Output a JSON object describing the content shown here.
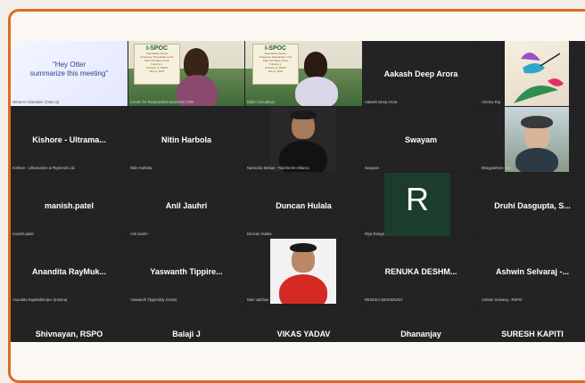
{
  "meeting": {
    "otter_prompt": "\"Hey Otter\nsummarize this meeting\"",
    "slide_title": "I-SPOC",
    "slide_lines": [
      "Traceability Series:",
      "Achieving Traceability in the",
      "Palm Oil Value Chain",
      "Training 1:",
      "prinsiple by RSPO",
      "May 8, 2024"
    ]
  },
  "tiles": [
    {
      "id": "otter",
      "label": "",
      "caption": "Miriam's Notetaker (Otter.ai)"
    },
    {
      "id": "crb",
      "label": "",
      "caption": "Centre for Responsible Business CRB"
    },
    {
      "id": "nidhi",
      "label": "",
      "caption": "Nidhi Choudhary"
    },
    {
      "id": "aakash",
      "label": "Aakash Deep Arora",
      "caption": "Aakash Deep Arora"
    },
    {
      "id": "chetna",
      "label": "",
      "caption": "Chetna Raj"
    },
    {
      "id": "kishore",
      "label": "Kishore - Ultrama...",
      "caption": "Kishore - Ultramarine & Pigments Ltd."
    },
    {
      "id": "nitinh",
      "label": "Nitin Harbola",
      "caption": "Nitin Harbola"
    },
    {
      "id": "narendra",
      "label": "",
      "caption": "Narendra Mohan - Rainforest Alliance"
    },
    {
      "id": "swayam",
      "label": "Swayam",
      "caption": "Swayam"
    },
    {
      "id": "bhagyashree",
      "label": "",
      "caption": "Bhagyashree Jain"
    },
    {
      "id": "manish",
      "label": "manish.patel",
      "caption": "manish.patel"
    },
    {
      "id": "anil",
      "label": "Anil Jauhri",
      "caption": "Anil Jauhri"
    },
    {
      "id": "duncan",
      "label": "Duncan Hulala",
      "caption": "Duncan Hulala"
    },
    {
      "id": "riya",
      "label": "",
      "caption": "Riya Ranga",
      "initial": "R"
    },
    {
      "id": "druhi",
      "label": "Druhi Dasgupta, S...",
      "caption": ""
    },
    {
      "id": "anandita",
      "label": "Anandita RayMuk...",
      "caption": "Anandita RayMukherjee (trustea)"
    },
    {
      "id": "yaswanth",
      "label": "Yaswanth Tippire...",
      "caption": "Yaswanth Tippireddy Godrej"
    },
    {
      "id": "nitinv",
      "label": "",
      "caption": "Nitin Vaibhav"
    },
    {
      "id": "renuka",
      "label": "RENUKA DESHM...",
      "caption": "RENUKA DESHMUKH"
    },
    {
      "id": "ashwin",
      "label": "Ashwin Selvaraj -...",
      "caption": "Ashwin Selvaraj - RSPO"
    },
    {
      "id": "shivnayan",
      "label": "Shivnayan, RSPO",
      "caption": ""
    },
    {
      "id": "balaji",
      "label": "Balaji J",
      "caption": ""
    },
    {
      "id": "vikas",
      "label": "VIKAS YADAV",
      "caption": ""
    },
    {
      "id": "dhananjay",
      "label": "Dhananjay",
      "caption": ""
    },
    {
      "id": "suresh",
      "label": "SURESH KAPITI",
      "caption": ""
    }
  ]
}
